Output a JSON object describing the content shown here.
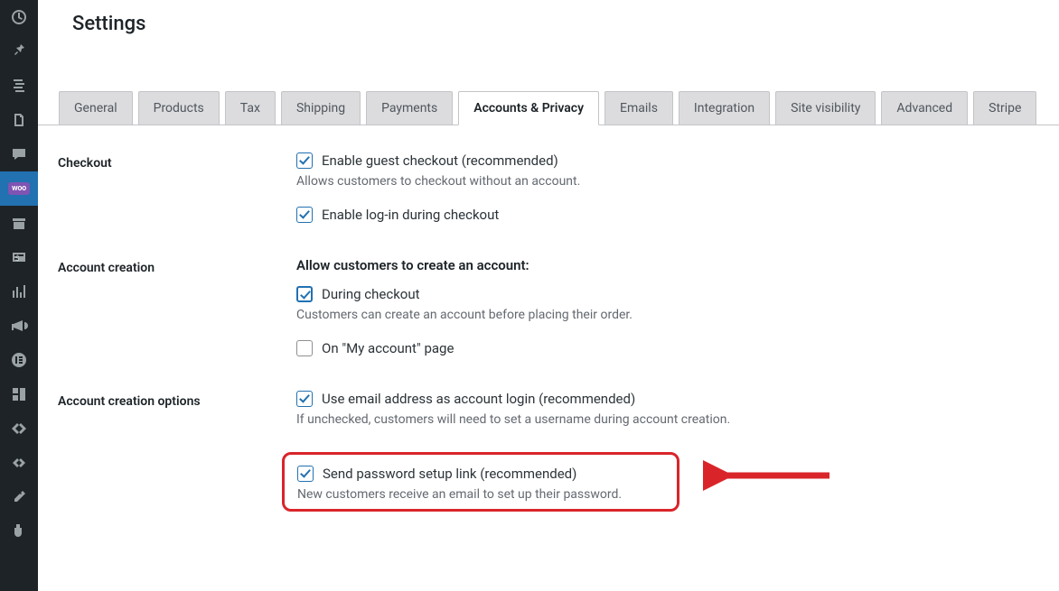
{
  "page_title": "Settings",
  "tabs": [
    {
      "label": "General"
    },
    {
      "label": "Products"
    },
    {
      "label": "Tax"
    },
    {
      "label": "Shipping"
    },
    {
      "label": "Payments"
    },
    {
      "label": "Accounts & Privacy"
    },
    {
      "label": "Emails"
    },
    {
      "label": "Integration"
    },
    {
      "label": "Site visibility"
    },
    {
      "label": "Advanced"
    },
    {
      "label": "Stripe"
    }
  ],
  "sections": {
    "checkout": {
      "title": "Checkout",
      "guest_label": "Enable guest checkout (recommended)",
      "guest_desc": "Allows customers to checkout without an account.",
      "login_label": "Enable log-in during checkout"
    },
    "account_creation": {
      "title": "Account creation",
      "subhead": "Allow customers to create an account:",
      "during_label": "During checkout",
      "during_desc": "Customers can create an account before placing their order.",
      "myaccount_label": "On \"My account\" page"
    },
    "account_options": {
      "title": "Account creation options",
      "email_label": "Use email address as account login (recommended)",
      "email_desc": "If unchecked, customers will need to set a username during account creation.",
      "pw_label": "Send password setup link (recommended)",
      "pw_desc": "New customers receive an email to set up their password."
    }
  },
  "woo_badge": "woo"
}
